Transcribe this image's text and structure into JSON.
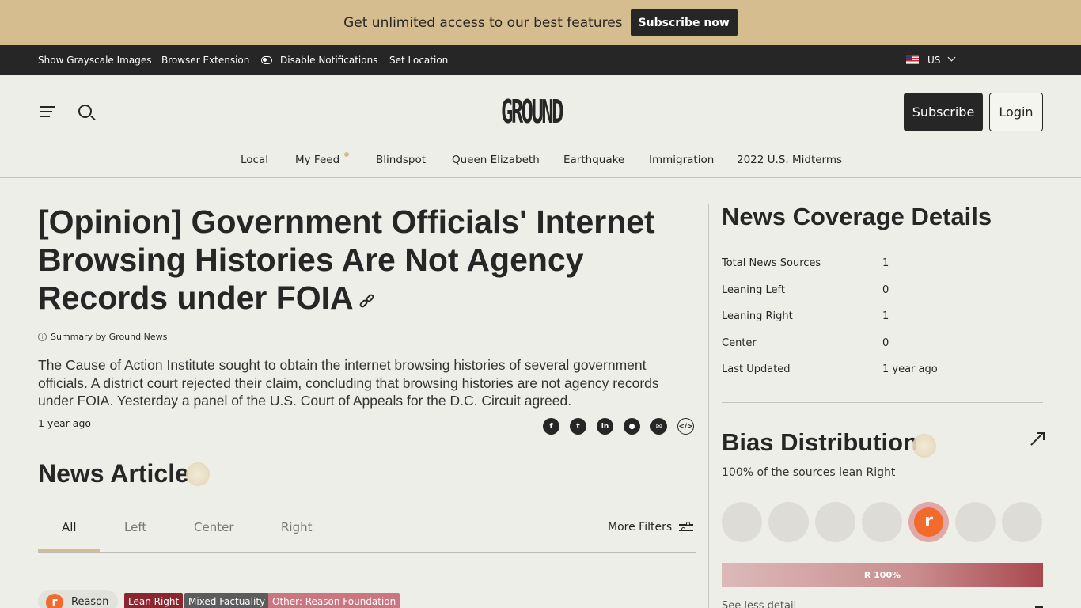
{
  "promo": {
    "text": "Get unlimited access to our best features",
    "button": "Subscribe now"
  },
  "utility_bar": {
    "grayscale": "Show Grayscale Images",
    "extension": "Browser Extension",
    "notifications": "Disable Notifications",
    "location": "Set Location",
    "region": "US"
  },
  "header": {
    "logo": "GROUND",
    "subscribe": "Subscribe",
    "login": "Login",
    "nav": [
      "Local",
      "My Feed",
      "Blindspot",
      "Queen Elizabeth",
      "Earthquake",
      "Immigration",
      "2022 U.S. Midterms"
    ]
  },
  "article": {
    "title": "[Opinion] Government Officials' Internet Browsing Histories Are Not Agency Records under FOIA",
    "summary_by": "Summary by Ground News",
    "summary": "The Cause of Action Institute sought to obtain the internet browsing histories of several government officials. A district court rejected their claim, concluding that browsing histories are not agency records under FOIA. Yesterday a panel of the U.S. Court of Appeals for the D.C. Circuit agreed.",
    "time_ago": "1 year ago",
    "share_icons": [
      "facebook-icon",
      "twitter-icon",
      "linkedin-icon",
      "reddit-icon",
      "email-icon",
      "embed-icon"
    ]
  },
  "news_articles": {
    "title": "News Article",
    "tabs": [
      "All",
      "Left",
      "Center",
      "Right"
    ],
    "active_tab": "All",
    "more_filters": "More Filters",
    "first_item": {
      "source_initial": "r",
      "source": "Reason",
      "tags": [
        {
          "label": "Lean Right",
          "color": "#8b2530"
        },
        {
          "label": "Mixed Factuality",
          "color": "#5c5c5c"
        },
        {
          "label": "Other: Reason Foundation",
          "color": "#c97680"
        }
      ]
    }
  },
  "coverage": {
    "title": "News Coverage Details",
    "rows": [
      {
        "label": "Total News Sources",
        "value": "1"
      },
      {
        "label": "Leaning Left",
        "value": "0"
      },
      {
        "label": "Leaning Right",
        "value": "1"
      },
      {
        "label": "Center",
        "value": "0"
      },
      {
        "label": "Last Updated",
        "value": "1 year ago"
      }
    ]
  },
  "bias": {
    "title": "Bias Distribution",
    "subtitle": "100% of the sources lean Right",
    "active_source_initial": "r",
    "active_slot": 5,
    "slots": 7,
    "bar_label": "R 100%",
    "right_share_pct": 100,
    "see_less": "See less detail"
  },
  "colors": {
    "accent": "#d6bd8f",
    "dark": "#262626",
    "lean_right": "#8b2530"
  }
}
